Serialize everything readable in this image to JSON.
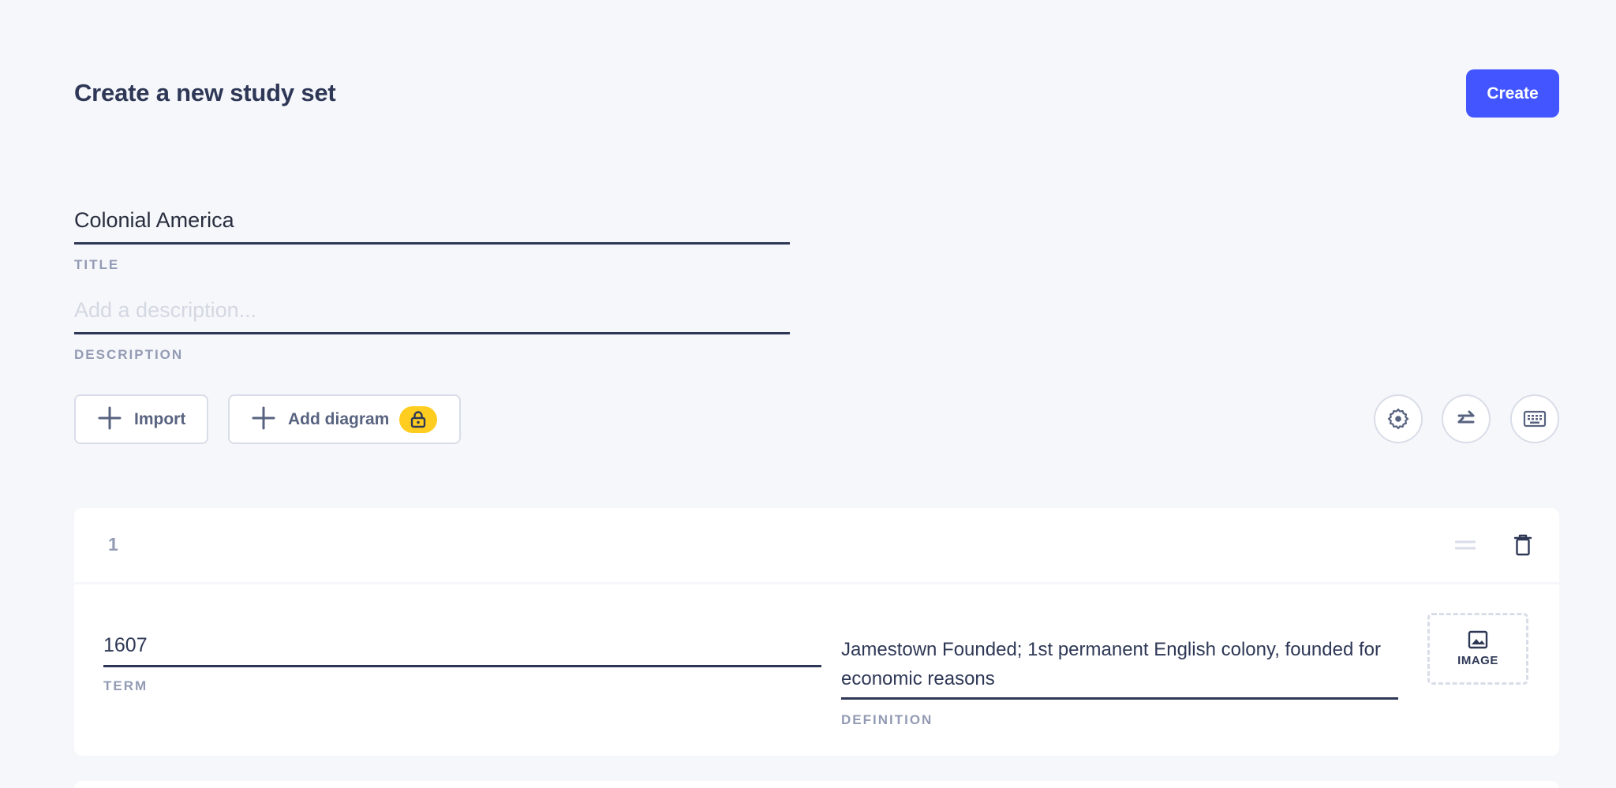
{
  "header": {
    "title": "Create a new study set",
    "create_label": "Create"
  },
  "title_field": {
    "value": "Colonial America",
    "caption": "TITLE"
  },
  "description_field": {
    "value": "",
    "placeholder": "Add a description...",
    "caption": "DESCRIPTION"
  },
  "toolbar": {
    "import_label": "Import",
    "add_diagram_label": "Add diagram",
    "icons": [
      "settings-icon",
      "swap-icon",
      "keyboard-icon"
    ]
  },
  "cards": [
    {
      "number": "1",
      "term": "1607",
      "term_caption": "TERM",
      "definition": "Jamestown Founded; 1st permanent English colony, founded for economic reasons",
      "definition_caption": "DEFINITION",
      "image_label": "IMAGE"
    }
  ],
  "colors": {
    "accent": "#4255ff",
    "background": "#f6f7fb",
    "text": "#2e3856",
    "muted": "#939bb4",
    "lock_badge": "#ffcd1f"
  }
}
